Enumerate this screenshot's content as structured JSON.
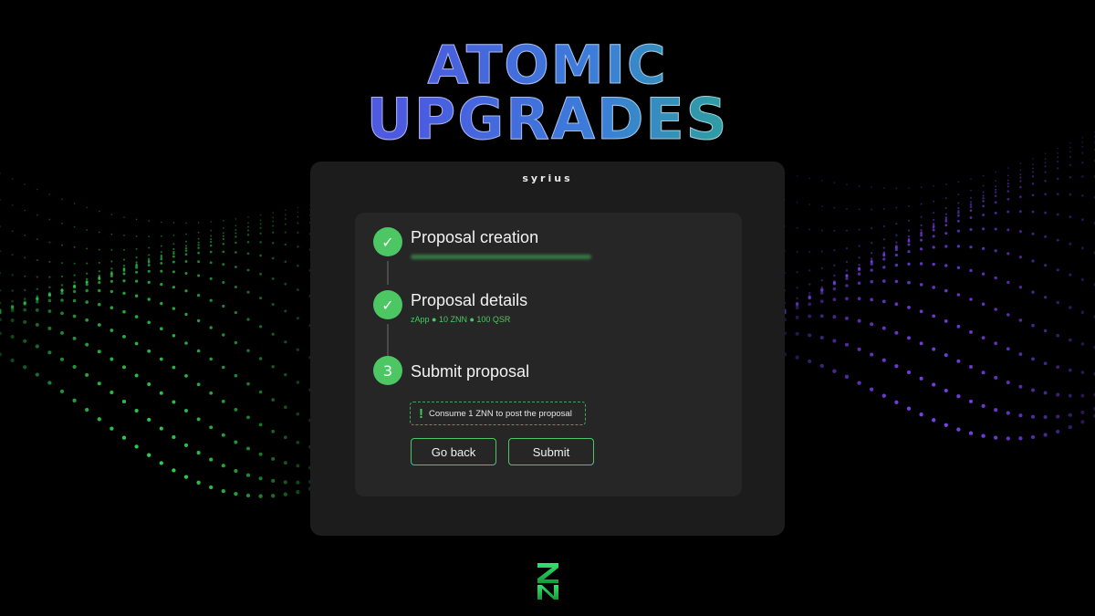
{
  "headline": {
    "line1": "ATOMIC",
    "line2": "UPGRADES"
  },
  "window": {
    "app_title": "syrius"
  },
  "steps": [
    {
      "number": "✓",
      "title": "Proposal creation",
      "subtitle": ""
    },
    {
      "number": "✓",
      "title": "Proposal details",
      "subtitle": "zApp ● 10 ZNN ● 100 QSR"
    },
    {
      "number": "3",
      "title": "Submit proposal",
      "subtitle": ""
    }
  ],
  "notice": {
    "icon": "exclamation-icon",
    "text": "Consume 1 ZNN to post the proposal"
  },
  "buttons": {
    "back_label": "Go back",
    "submit_label": "Submit"
  },
  "colors": {
    "accent_green": "#4cc763",
    "panel": "#262626",
    "window": "#1c1c1c",
    "wave_green": "#2fcf4f",
    "wave_purple": "#7b3ff0"
  }
}
